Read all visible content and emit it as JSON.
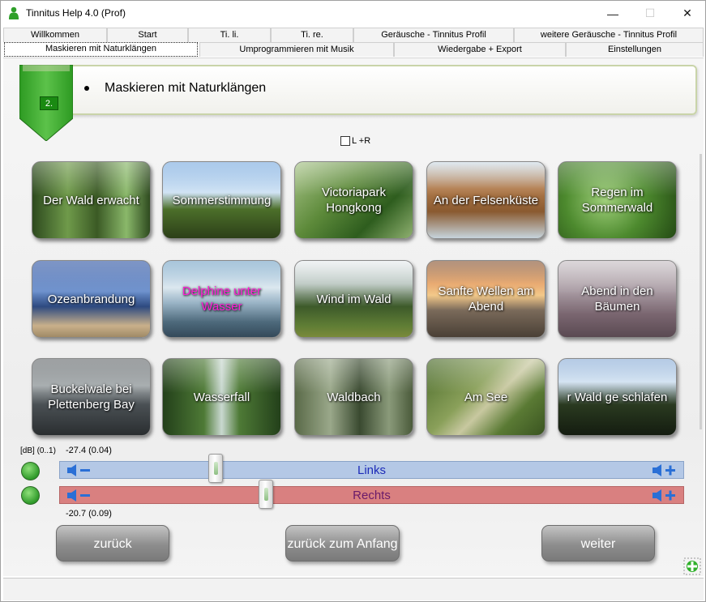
{
  "window": {
    "title": "Tinnitus Help 4.0 (Prof)",
    "controls": {
      "minimize": "—",
      "maximize": "☐",
      "close": "✕"
    }
  },
  "tabs_row1": [
    "Willkommen",
    "Start",
    "Ti. li.",
    "Ti. re.",
    "Geräusche - Tinnitus Profil",
    "weitere Geräusche - Tinnitus Profil"
  ],
  "tabs_row2": [
    "Maskieren mit Naturklängen",
    "Umprogrammieren mit Musik",
    "Wiedergabe + Export",
    "Einstellungen"
  ],
  "active_tab": "Maskieren mit Naturklängen",
  "header": {
    "step": "2.",
    "title": "Maskieren mit Naturklängen"
  },
  "lr_checkbox": {
    "label": "L +R",
    "checked": false
  },
  "tiles": [
    {
      "label": "Der Wald erwacht"
    },
    {
      "label": "Sommerstimmung"
    },
    {
      "label": "Victoriapark Hongkong"
    },
    {
      "label": "An der Felsenküste"
    },
    {
      "label": "Regen im Sommerwald"
    },
    {
      "label": "Ozeanbrandung"
    },
    {
      "label": "Delphine unter Wasser",
      "color": "#ff1cd6"
    },
    {
      "label": "Wind im Wald"
    },
    {
      "label": "Sanfte Wellen am Abend"
    },
    {
      "label": "Abend in den Bäumen"
    },
    {
      "label": "Buckelwale bei Plettenberg Bay"
    },
    {
      "label": "Wasserfall"
    },
    {
      "label": "Waldbach"
    },
    {
      "label": "Am See"
    },
    {
      "label": "r Wald ge schlafen"
    }
  ],
  "volume": {
    "unit_label": "[dB] (0..1)",
    "left": {
      "readout": "-27.4 (0.04)",
      "label": "Links",
      "level": 0.04
    },
    "right": {
      "readout": "-20.7 (0.09)",
      "label": "Rechts",
      "level": 0.09
    }
  },
  "nav": {
    "back": "zurück",
    "to_start": "zurück zum Anfang",
    "next": "weiter"
  },
  "colors": {
    "accent_green": "#1a8a12",
    "left_bar": "#b4c8e6",
    "right_bar": "#d98080",
    "speaker_blue": "#2a6fd6"
  }
}
